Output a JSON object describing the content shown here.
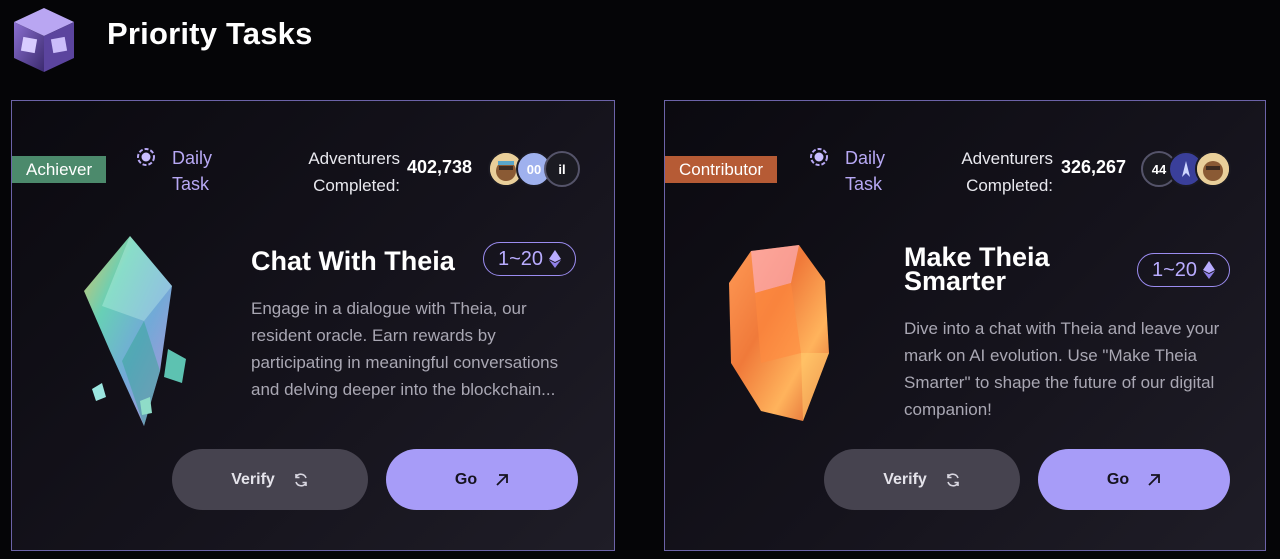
{
  "header": {
    "title": "Priority Tasks",
    "logo_icon": "cube-logo-icon"
  },
  "colors": {
    "accent": "#a79cf8",
    "achiever": "#4c8a6c",
    "contributor": "#b65b35",
    "verify_bg": "#46434f"
  },
  "cards": [
    {
      "badge": "Achiever",
      "daily_line1": "Daily",
      "daily_line2": "Task",
      "adv_line1": "Adventurers",
      "adv_line2": "Completed:",
      "count": "402,738",
      "avatar_texts": [
        "",
        "00",
        "il"
      ],
      "title": "Chat With Theia",
      "reward": "1~20",
      "description": "Engage in a dialogue with Theia, our resident oracle. Earn rewards by participating in meaningful conversations and delving deeper into the blockchain...",
      "verify_label": "Verify",
      "go_label": "Go"
    },
    {
      "badge": "Contributor",
      "daily_line1": "Daily",
      "daily_line2": "Task",
      "adv_line1": "Adventurers",
      "adv_line2": "Completed:",
      "count": "326,267",
      "avatar_texts": [
        "44",
        "",
        ""
      ],
      "title_line1": "Make Theia",
      "title_line2": "Smarter",
      "reward": "1~20",
      "description": "Dive into a chat with Theia and leave your mark on AI evolution. Use \"Make Theia Smarter\" to shape the future of our digital companion!",
      "verify_label": "Verify",
      "go_label": "Go"
    }
  ]
}
